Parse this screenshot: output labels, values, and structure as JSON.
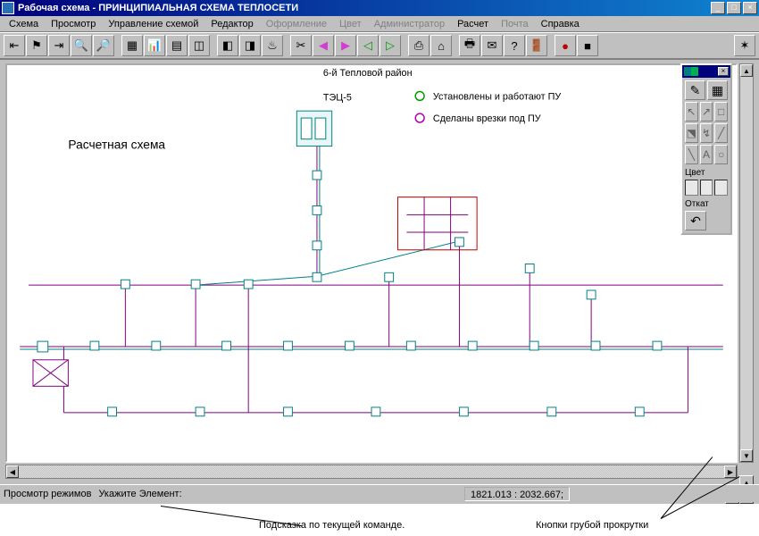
{
  "window": {
    "title": "Рабочая схема - ПРИНЦИПИАЛЬНАЯ СХЕМА ТЕПЛОСЕТИ",
    "minimize": "_",
    "maximize": "□",
    "close": "×"
  },
  "menu": {
    "items": [
      {
        "label": "Схема",
        "enabled": true
      },
      {
        "label": "Просмотр",
        "enabled": true
      },
      {
        "label": "Управление схемой",
        "enabled": true
      },
      {
        "label": "Редактор",
        "enabled": true
      },
      {
        "label": "Оформление",
        "enabled": false
      },
      {
        "label": "Цвет",
        "enabled": false
      },
      {
        "label": "Администратор",
        "enabled": false
      },
      {
        "label": "Расчет",
        "enabled": true
      },
      {
        "label": "Почта",
        "enabled": false
      },
      {
        "label": "Справка",
        "enabled": true
      }
    ]
  },
  "toolbar": {
    "buttons": [
      {
        "name": "arrow-prev",
        "glyph": "⇤"
      },
      {
        "name": "flag",
        "glyph": "⚑"
      },
      {
        "name": "arrow-next",
        "glyph": "⇥"
      },
      {
        "name": "zoom-in",
        "glyph": "🔍"
      },
      {
        "name": "zoom-out",
        "glyph": "🔎"
      },
      {
        "name": "sep"
      },
      {
        "name": "grid",
        "glyph": "▦"
      },
      {
        "name": "chart",
        "glyph": "📊"
      },
      {
        "name": "table",
        "glyph": "▤"
      },
      {
        "name": "layers",
        "glyph": "◫"
      },
      {
        "name": "sep"
      },
      {
        "name": "edit1",
        "glyph": "◧"
      },
      {
        "name": "edit2",
        "glyph": "◨"
      },
      {
        "name": "fire",
        "glyph": "♨"
      },
      {
        "name": "sep"
      },
      {
        "name": "cut",
        "glyph": "✂"
      },
      {
        "name": "back-pink",
        "glyph": "◀"
      },
      {
        "name": "fwd-pink",
        "glyph": "▶"
      },
      {
        "name": "back-green",
        "glyph": "◁"
      },
      {
        "name": "fwd-green",
        "glyph": "▷"
      },
      {
        "name": "sep"
      },
      {
        "name": "tool-a",
        "glyph": "⎙"
      },
      {
        "name": "tool-b",
        "glyph": "⌂"
      },
      {
        "name": "sep"
      },
      {
        "name": "print",
        "glyph": "🖶"
      },
      {
        "name": "mail",
        "glyph": "✉"
      },
      {
        "name": "help",
        "glyph": "?"
      },
      {
        "name": "exit",
        "glyph": "🚪"
      },
      {
        "name": "sep"
      },
      {
        "name": "record",
        "glyph": "●"
      },
      {
        "name": "stop",
        "glyph": "■"
      },
      {
        "name": "sep-wide"
      },
      {
        "name": "map",
        "glyph": "✶"
      }
    ]
  },
  "canvas": {
    "header": "6-й Тепловой район",
    "station": "ТЭЦ-5",
    "caption": "Расчетная схема",
    "legend": [
      {
        "color": "#009a00",
        "text": "Установлены и работают ПУ"
      },
      {
        "color": "#b000b0",
        "text": "Сделаны врезки под ПУ"
      }
    ]
  },
  "palette": {
    "section_color": "Цвет",
    "section_undo": "Откат",
    "swatches_title": [
      "#008080",
      "#00b050"
    ],
    "icons_row1": [
      "✎",
      "▦"
    ],
    "tool_cells": [
      "↖",
      "↗",
      "□",
      "⬔",
      "↯",
      "╱",
      "╲",
      "A",
      "○"
    ]
  },
  "scroll": {
    "up": "▲",
    "down": "▼",
    "left": "◀",
    "right": "▶"
  },
  "coarse": {
    "up": "▲",
    "down": "▼",
    "left": "◀",
    "right": "▶"
  },
  "status": {
    "mode": "Просмотр режимов",
    "hint": "Укажите Элемент:",
    "coords": "1821.013 : 2032.667;"
  },
  "annotations": {
    "hint": "Подсказка по текущей команде.",
    "coarse": "Кнопки грубой прокрутки"
  }
}
